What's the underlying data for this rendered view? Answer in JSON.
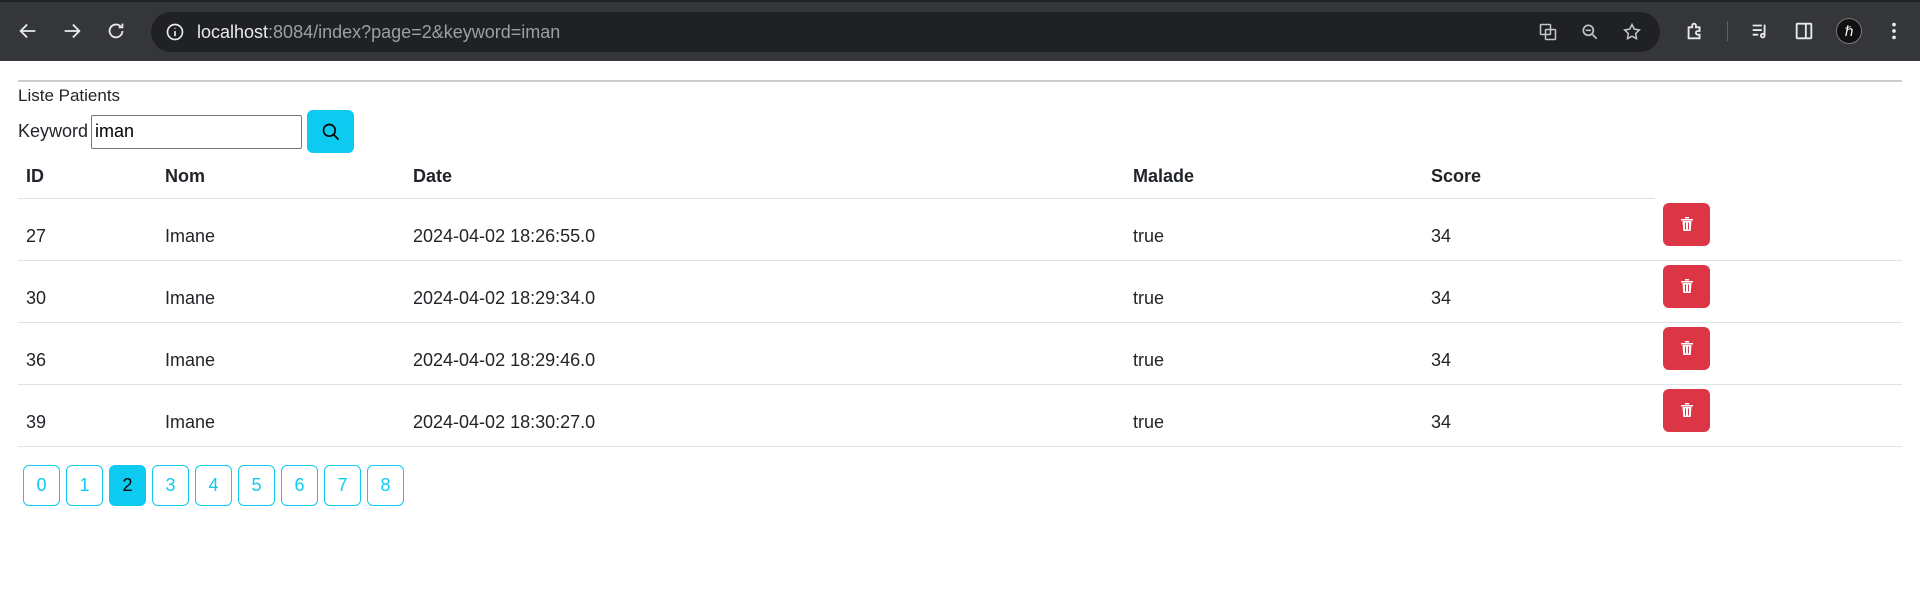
{
  "browser": {
    "url_host": "localhost",
    "url_rest": ":8084/index?page=2&keyword=iman"
  },
  "page": {
    "heading": "Liste Patients",
    "search": {
      "label": "Keyword",
      "value": "iman"
    },
    "table": {
      "headers": [
        "ID",
        "Nom",
        "Date",
        "Malade",
        "Score"
      ],
      "rows": [
        {
          "id": "27",
          "nom": "Imane",
          "date": "2024-04-02 18:26:55.0",
          "malade": "true",
          "score": "34"
        },
        {
          "id": "30",
          "nom": "Imane",
          "date": "2024-04-02 18:29:34.0",
          "malade": "true",
          "score": "34"
        },
        {
          "id": "36",
          "nom": "Imane",
          "date": "2024-04-02 18:29:46.0",
          "malade": "true",
          "score": "34"
        },
        {
          "id": "39",
          "nom": "Imane",
          "date": "2024-04-02 18:30:27.0",
          "malade": "true",
          "score": "34"
        }
      ]
    },
    "pagination": {
      "pages": [
        "0",
        "1",
        "2",
        "3",
        "4",
        "5",
        "6",
        "7",
        "8"
      ],
      "current": "2"
    }
  },
  "colors": {
    "info": "#0dcaf0",
    "danger": "#dc3545",
    "chrome": "#35363a"
  }
}
